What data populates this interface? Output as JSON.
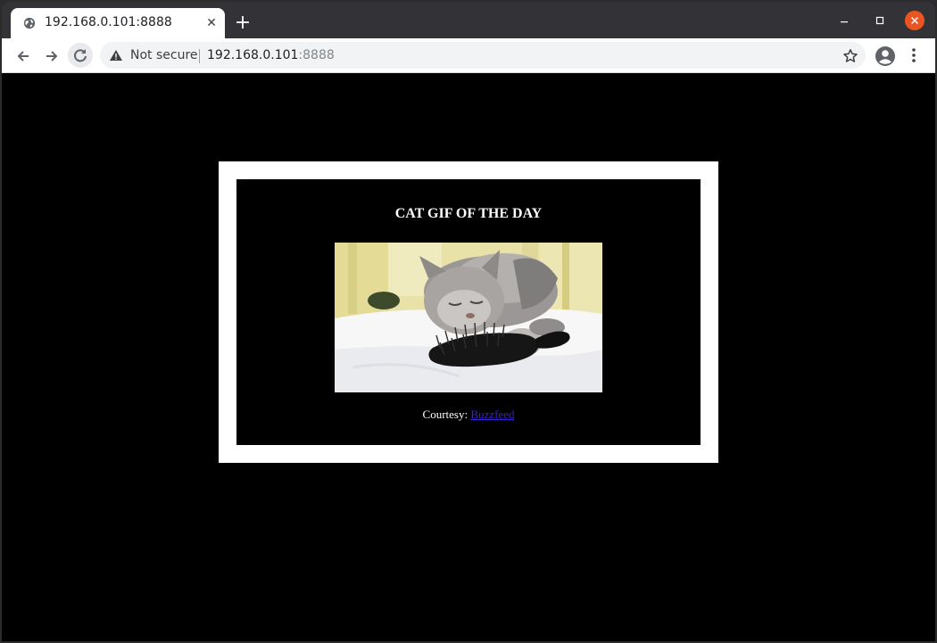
{
  "browser": {
    "tab_title": "192.168.0.101:8888",
    "security_label": "Not secure",
    "url_host": "192.168.0.101",
    "url_port": ":8888",
    "close_button_color": "#e95420"
  },
  "page": {
    "heading": "CAT GIF OF THE DAY",
    "image_subject": "gray fluffy cat hugging a black hairbrush on a white towel",
    "courtesy_label": "Courtesy: ",
    "courtesy_link": "Buzzfeed",
    "link_color": "#3d1fd6"
  }
}
